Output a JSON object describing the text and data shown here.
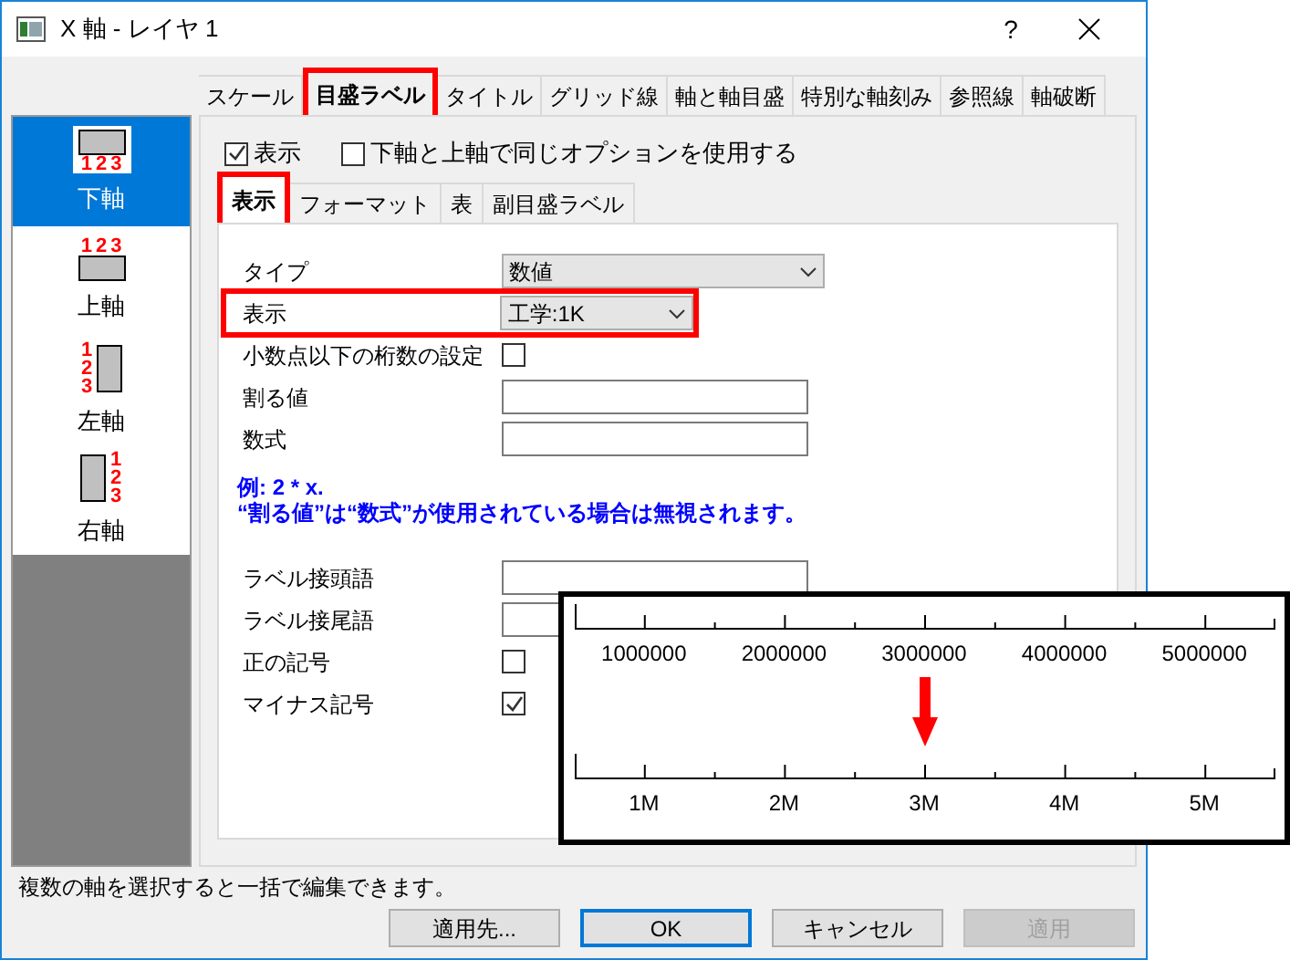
{
  "window": {
    "title": "X 軸 - レイヤ 1",
    "help": "?"
  },
  "tabs": [
    {
      "label": "スケール",
      "selected": false,
      "highlighted": false
    },
    {
      "label": "目盛ラベル",
      "selected": true,
      "highlighted": true
    },
    {
      "label": "タイトル",
      "selected": false,
      "highlighted": false
    },
    {
      "label": "グリッド線",
      "selected": false,
      "highlighted": false
    },
    {
      "label": "軸と軸目盛",
      "selected": false,
      "highlighted": false
    },
    {
      "label": "特別な軸刻み",
      "selected": false,
      "highlighted": false
    },
    {
      "label": "参照線",
      "selected": false,
      "highlighted": false
    },
    {
      "label": "軸破断",
      "selected": false,
      "highlighted": false
    }
  ],
  "sidebar": {
    "items": [
      {
        "label": "下軸",
        "kind": "bottom",
        "icon_labels": [
          "1",
          "2",
          "3"
        ],
        "selected": true
      },
      {
        "label": "上軸",
        "kind": "top",
        "icon_labels": [
          "1",
          "2",
          "3"
        ],
        "selected": false
      },
      {
        "label": "左軸",
        "kind": "left",
        "icon_labels": [
          "1",
          "2",
          "3"
        ],
        "selected": false
      },
      {
        "label": "右軸",
        "kind": "right",
        "icon_labels": [
          "1",
          "2",
          "3"
        ],
        "selected": false
      }
    ]
  },
  "options": [
    {
      "label": "表示",
      "checked": true
    },
    {
      "label": "下軸と上軸で同じオプションを使用する",
      "checked": false
    }
  ],
  "subtabs": [
    {
      "label": "表示",
      "selected": true,
      "highlighted": true
    },
    {
      "label": "フォーマット",
      "selected": false,
      "highlighted": false
    },
    {
      "label": "表",
      "selected": false,
      "highlighted": false
    },
    {
      "label": "副目盛ラベル",
      "selected": false,
      "highlighted": false
    }
  ],
  "fields": [
    {
      "label": "タイプ",
      "kind": "dropdown",
      "value": "数値",
      "wide": true,
      "highlighted": false
    },
    {
      "label": "表示",
      "kind": "dropdown",
      "value": "工学:1K",
      "wide": false,
      "highlighted": true
    },
    {
      "label": "小数点以下の桁数の設定",
      "kind": "checkbox",
      "checked": false,
      "highlighted": false
    },
    {
      "label": "割る値",
      "kind": "text",
      "highlighted": false
    },
    {
      "label": "数式",
      "kind": "text",
      "highlighted": false
    },
    {
      "kind": "note",
      "lines": [
        "例: 2 * x.",
        "“割る値”は“数式”が使用されている場合は無視されます。"
      ]
    },
    {
      "label": "ラベル接頭語",
      "kind": "text",
      "highlighted": false
    },
    {
      "label": "ラベル接尾語",
      "kind": "text",
      "highlighted": false
    },
    {
      "label": "正の記号",
      "kind": "checkbox",
      "checked": false,
      "highlighted": false
    },
    {
      "label": "マイナス記号",
      "kind": "checkbox",
      "checked": true,
      "highlighted": false
    }
  ],
  "inset": {
    "top_axis_labels": [
      "1000000",
      "2000000",
      "3000000",
      "4000000",
      "5000000"
    ],
    "bottom_axis_labels": [
      "1M",
      "2M",
      "3M",
      "4M",
      "5M"
    ]
  },
  "status_bar": "複数の軸を選択すると一括で編集できます。",
  "buttons": [
    {
      "label": "適用先...",
      "disabled": false,
      "default": false
    },
    {
      "label": "OK",
      "disabled": false,
      "default": true
    },
    {
      "label": "キャンセル",
      "disabled": false,
      "default": false
    },
    {
      "label": "適用",
      "disabled": true,
      "default": false
    }
  ]
}
